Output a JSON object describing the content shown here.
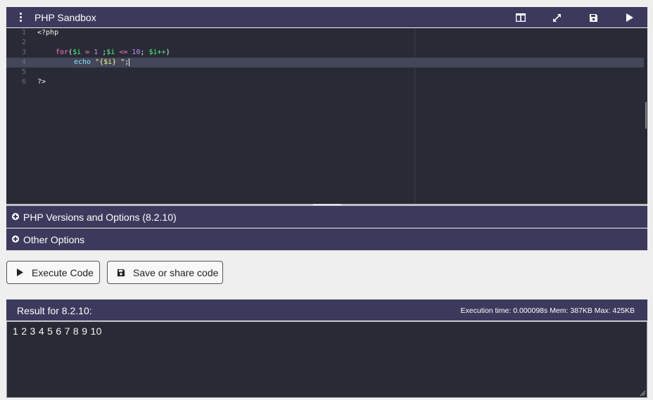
{
  "header": {
    "title": "PHP Sandbox"
  },
  "editor": {
    "lines": [
      {
        "n": "1",
        "text": "<?php"
      },
      {
        "n": "2",
        "text": ""
      },
      {
        "n": "3",
        "text": "for($i = 1 ;$i <= 10; $i++)"
      },
      {
        "n": "4",
        "text": "echo \"{$i} \";"
      },
      {
        "n": "5",
        "text": ""
      },
      {
        "n": "6",
        "text": "?>"
      }
    ],
    "tokens": {
      "open_tag": "<?php",
      "for": "for",
      "paren_open": "(",
      "var_i": "$i",
      "eq": " = ",
      "one": "1",
      "sp_semi": " ;",
      "le": " <= ",
      "ten": "10",
      "semi_sp": "; ",
      "var_ipp": "$i++",
      "paren_close": ")",
      "echo": "echo",
      "str": "\"{$i} \"",
      "semi": ";",
      "close_tag": "?>"
    }
  },
  "accordions": {
    "versions": "PHP Versions and Options (8.2.10)",
    "other": "Other Options"
  },
  "buttons": {
    "execute": "Execute Code",
    "save": "Save or share code"
  },
  "result": {
    "title": "Result for 8.2.10:",
    "stats": "Execution time: 0.000098s Mem: 387KB Max: 425KB",
    "output": "1 2 3 4 5 6 7 8 9 10"
  },
  "colors": {
    "header_bg": "#3c3a5c",
    "editor_bg": "#282a36"
  },
  "icons": [
    "kebab-menu-icon",
    "split-layout-icon",
    "expand-icon",
    "save-icon",
    "play-icon",
    "plus-circle-icon"
  ]
}
